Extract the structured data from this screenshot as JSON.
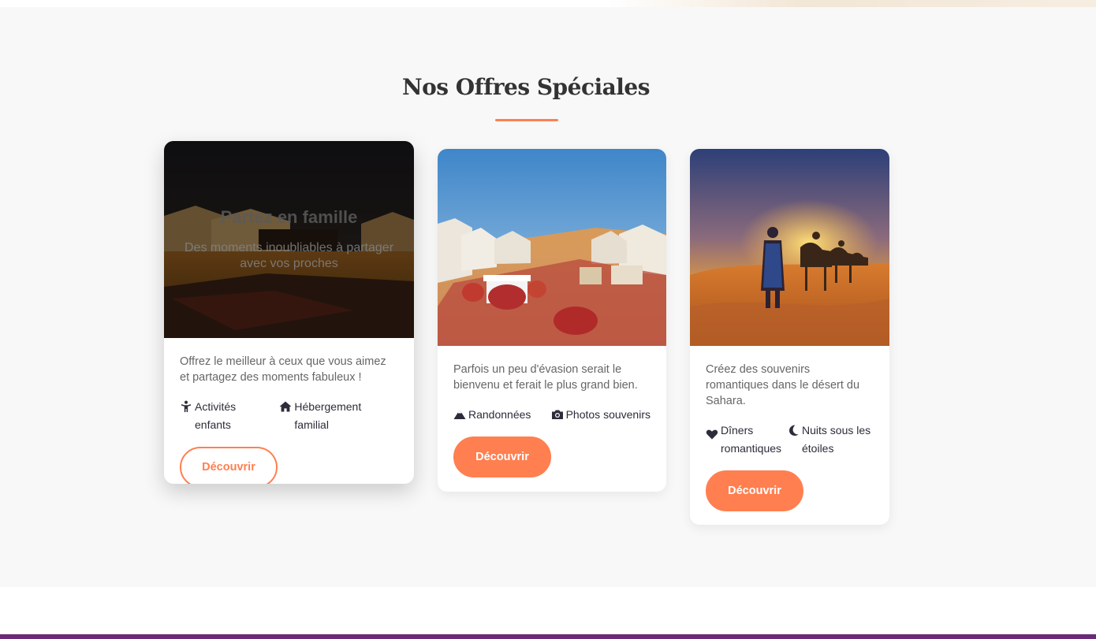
{
  "section": {
    "title": "Nos Offres Spéciales"
  },
  "colors": {
    "accent": "#ff7f50",
    "text_dark": "#333333",
    "text_muted": "#666666",
    "footer": "#6b2a78"
  },
  "offers": [
    {
      "overlay_title": "Partez en famille",
      "overlay_subtitle": "Des moments inoubliables à partager avec vos proches",
      "description": "Offrez le meilleur à ceux que vous aimez et partagez des moments fabuleux !",
      "features": [
        {
          "icon": "child-icon",
          "label": "Activités enfants"
        },
        {
          "icon": "home-icon",
          "label": "Hébergement familial"
        }
      ],
      "button_label": "Découvrir"
    },
    {
      "description": "Parfois un peu d'évasion serait le bienvenu et ferait le plus grand bien.",
      "features": [
        {
          "icon": "mountain-icon",
          "label": "Randonnées"
        },
        {
          "icon": "camera-icon",
          "label": "Photos souvenirs"
        }
      ],
      "button_label": "Découvrir"
    },
    {
      "description": "Créez des souvenirs romantiques dans le désert du Sahara.",
      "features": [
        {
          "icon": "heart-icon",
          "label": "Dîners romantiques"
        },
        {
          "icon": "moon-icon",
          "label": "Nuits sous les étoiles"
        }
      ],
      "button_label": "Découvrir"
    }
  ]
}
